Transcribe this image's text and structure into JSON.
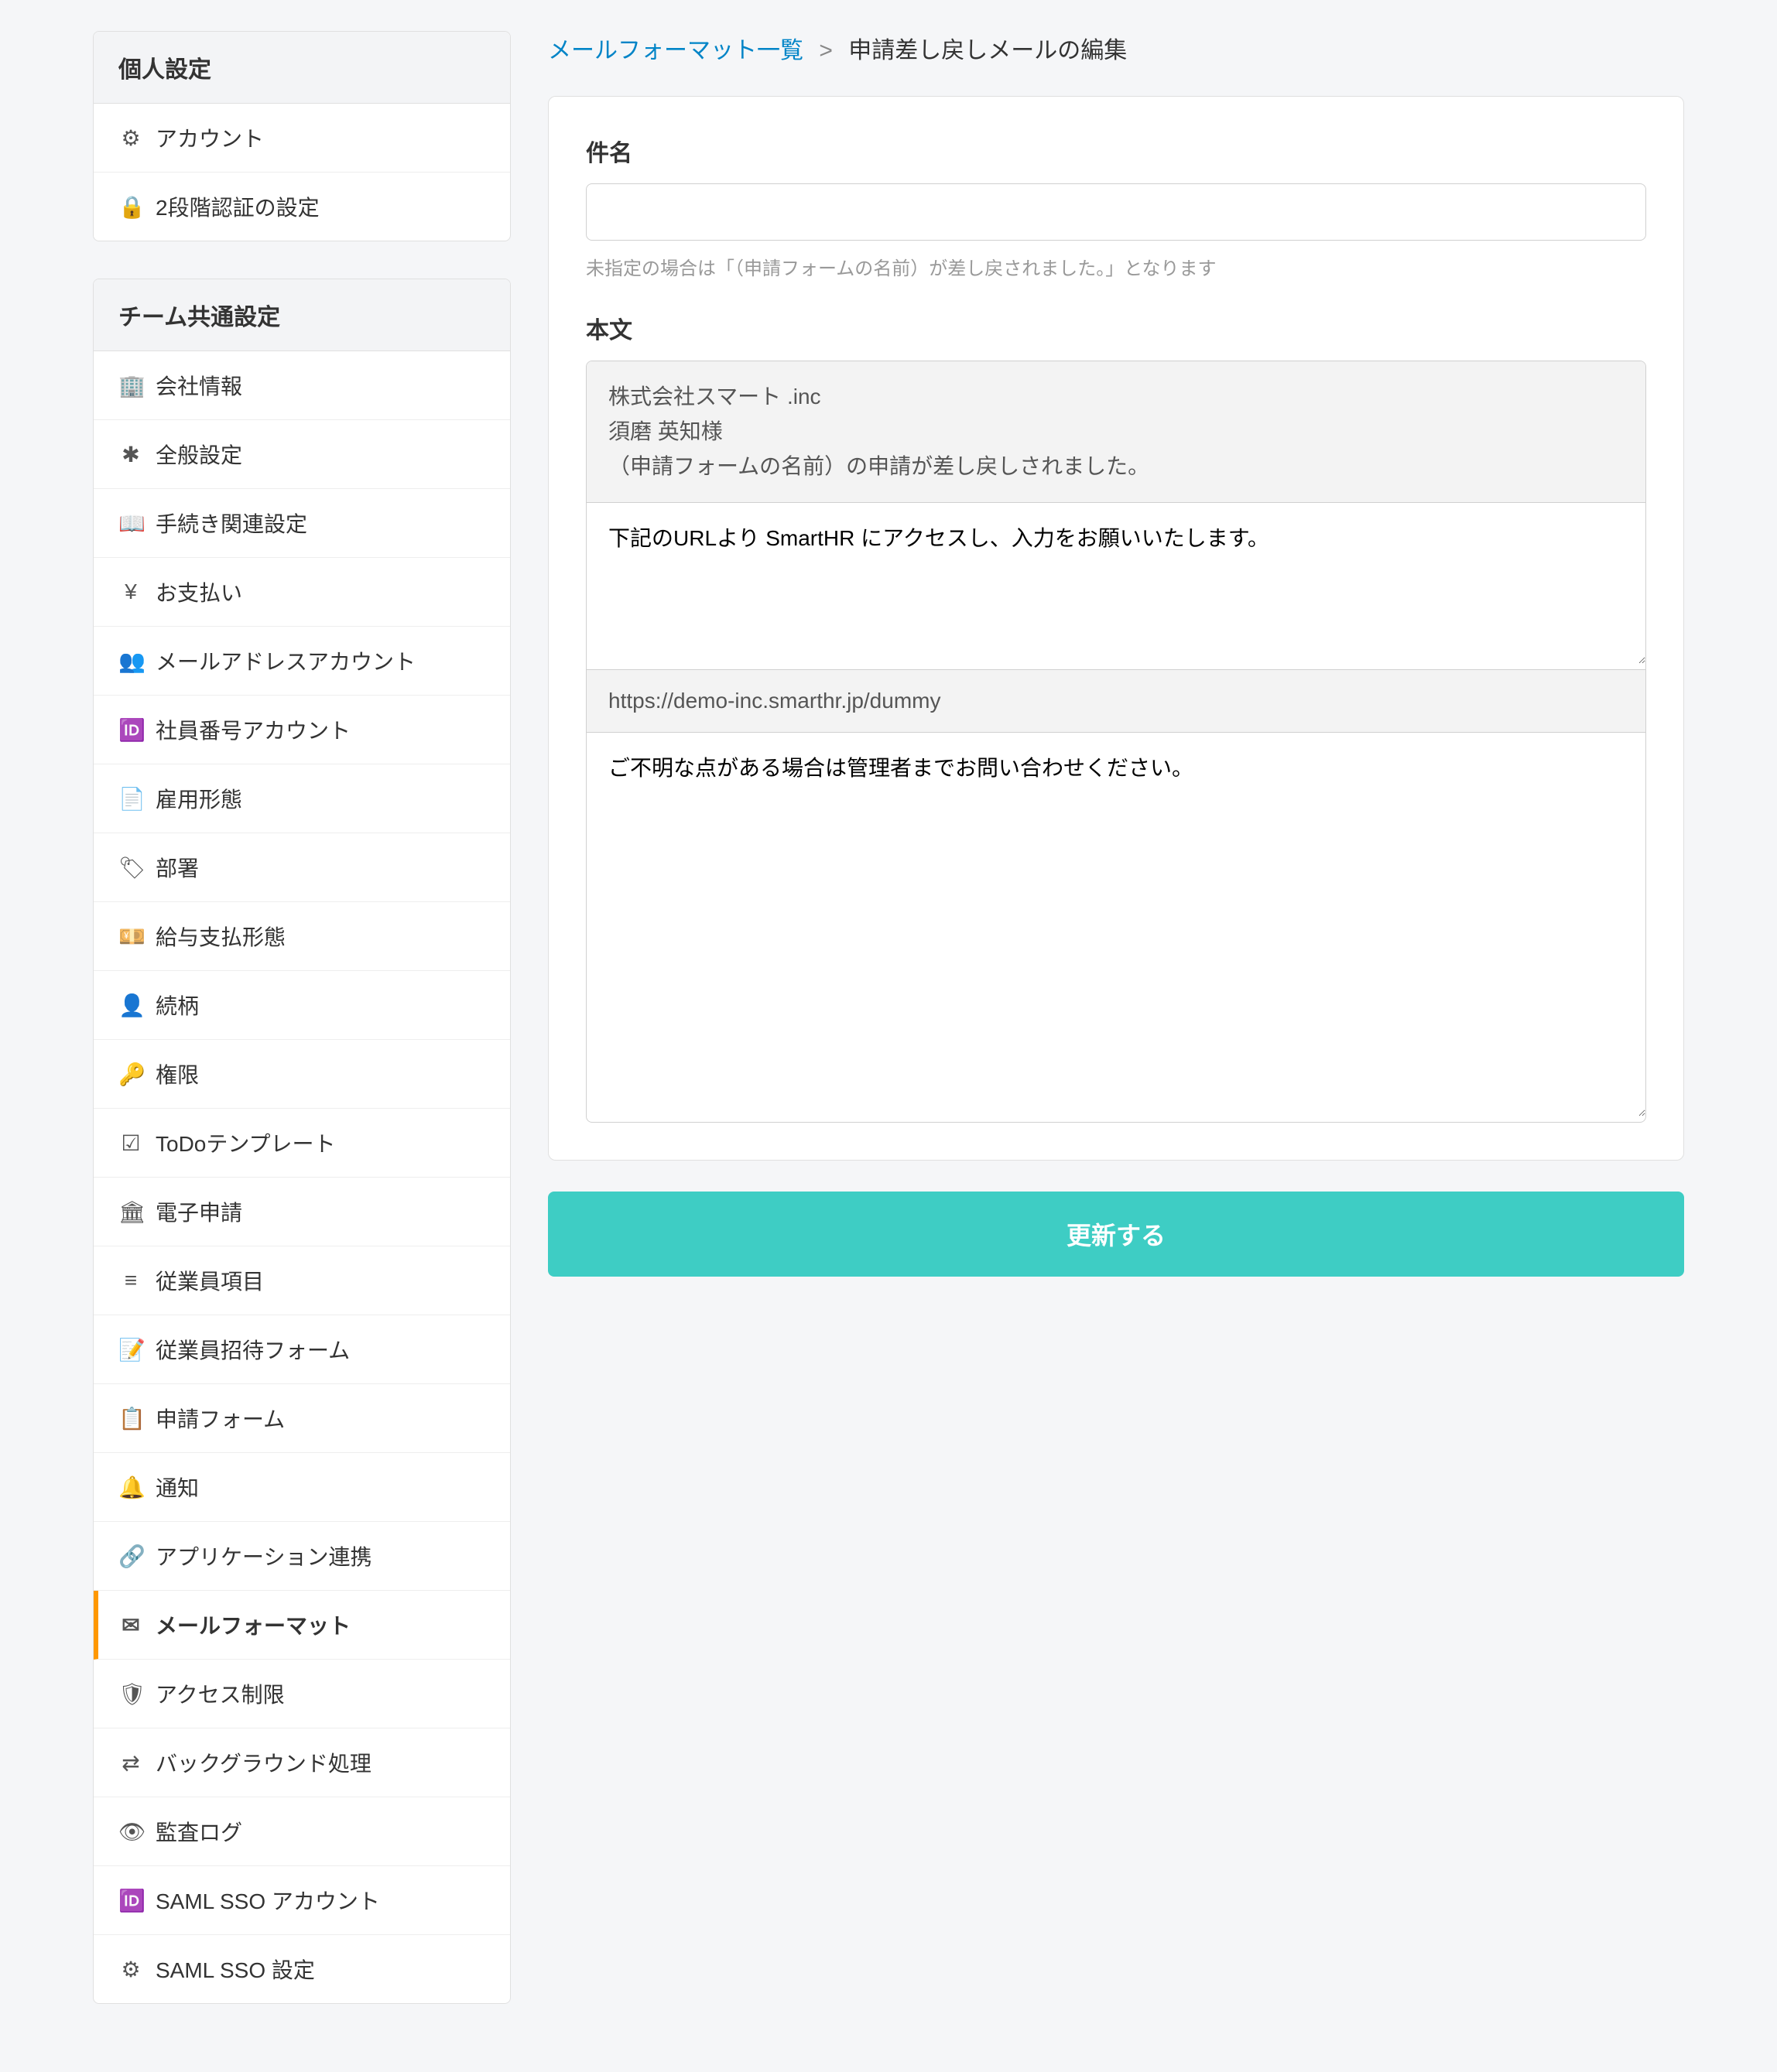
{
  "sidebar": {
    "section1": {
      "title": "個人設定",
      "items": [
        {
          "icon": "⚙",
          "label": "アカウント"
        },
        {
          "icon": "🔒",
          "label": "2段階認証の設定"
        }
      ]
    },
    "section2": {
      "title": "チーム共通設定",
      "items": [
        {
          "icon": "🏢",
          "label": "会社情報"
        },
        {
          "icon": "✱",
          "label": "全般設定"
        },
        {
          "icon": "📖",
          "label": "手続き関連設定"
        },
        {
          "icon": "¥",
          "label": "お支払い"
        },
        {
          "icon": "👥",
          "label": "メールアドレスアカウント"
        },
        {
          "icon": "🆔",
          "label": "社員番号アカウント"
        },
        {
          "icon": "📄",
          "label": "雇用形態"
        },
        {
          "icon": "🏷",
          "label": "部署"
        },
        {
          "icon": "💴",
          "label": "給与支払形態"
        },
        {
          "icon": "👤",
          "label": "続柄"
        },
        {
          "icon": "🔑",
          "label": "権限"
        },
        {
          "icon": "☑",
          "label": "ToDoテンプレート"
        },
        {
          "icon": "🏛",
          "label": "電子申請"
        },
        {
          "icon": "≡",
          "label": "従業員項目"
        },
        {
          "icon": "📝",
          "label": "従業員招待フォーム"
        },
        {
          "icon": "📋",
          "label": "申請フォーム"
        },
        {
          "icon": "🔔",
          "label": "通知"
        },
        {
          "icon": "🔗",
          "label": "アプリケーション連携"
        },
        {
          "icon": "✉",
          "label": "メールフォーマット",
          "active": true
        },
        {
          "icon": "🛡",
          "label": "アクセス制限"
        },
        {
          "icon": "⇄",
          "label": "バックグラウンド処理"
        },
        {
          "icon": "👁",
          "label": "監査ログ"
        },
        {
          "icon": "🆔",
          "label": "SAML SSO アカウント"
        },
        {
          "icon": "⚙",
          "label": "SAML SSO 設定"
        }
      ]
    }
  },
  "breadcrumb": {
    "link": "メールフォーマット一覧",
    "sep": ">",
    "current": "申請差し戻しメールの編集"
  },
  "form": {
    "subject_label": "件名",
    "subject_value": "",
    "subject_help": "未指定の場合は「（申請フォームの名前）が差し戻されました。」となります",
    "body_label": "本文",
    "body_fixed_top": "株式会社スマート .inc\n須磨 英知様\n（申請フォームの名前）の申請が差し戻しされました。",
    "body_text1": "下記のURLより SmartHR にアクセスし、入力をお願いいたします。",
    "body_url": "https://demo-inc.smarthr.jp/dummy",
    "body_text2": "ご不明な点がある場合は管理者までお問い合わせください。",
    "submit_label": "更新する"
  }
}
